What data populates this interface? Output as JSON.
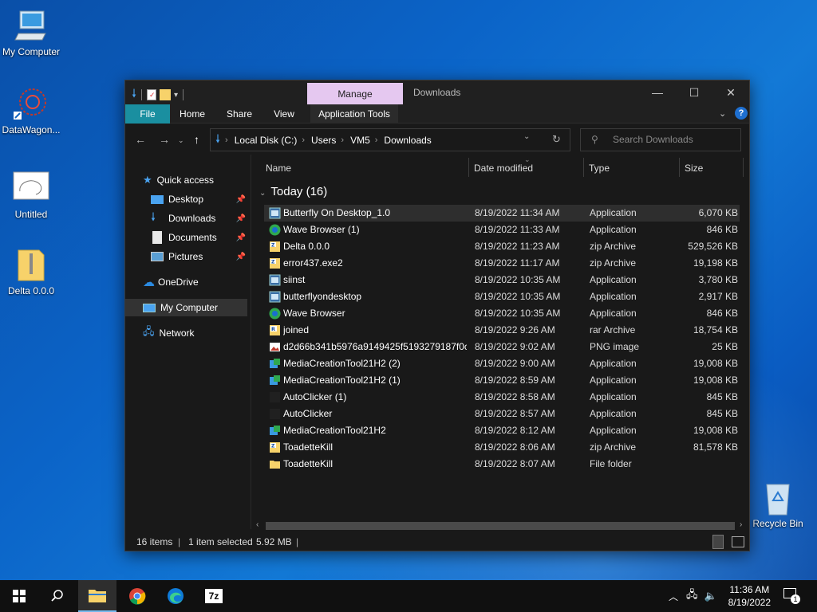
{
  "desktop": {
    "icons": [
      {
        "label": "My Computer"
      },
      {
        "label": "DataWagon..."
      },
      {
        "label": "Untitled"
      },
      {
        "label": "Delta 0.0.0"
      },
      {
        "label": "Recycle Bin"
      }
    ]
  },
  "window": {
    "manage_tab": "Manage",
    "title": "Downloads",
    "ribbon_tabs": [
      "File",
      "Home",
      "Share",
      "View",
      "Application Tools"
    ],
    "controls": {
      "minimize": "—",
      "maximize": "☐",
      "close": "✕"
    }
  },
  "address": {
    "crumbs": [
      "Local Disk (C:)",
      "Users",
      "VM5",
      "Downloads"
    ],
    "search_placeholder": "Search Downloads"
  },
  "nav": {
    "quick_access": "Quick access",
    "pinned": [
      "Desktop",
      "Downloads",
      "Documents",
      "Pictures"
    ],
    "onedrive": "OneDrive",
    "my_computer": "My Computer",
    "network": "Network"
  },
  "columns": {
    "name": "Name",
    "date": "Date modified",
    "type": "Type",
    "size": "Size"
  },
  "group": {
    "label": "Today (16)"
  },
  "files": [
    {
      "name": "Butterfly On Desktop_1.0",
      "date": "8/19/2022 11:34 AM",
      "type": "Application",
      "size": "6,070 KB",
      "icon": "app-installer-icon",
      "selected": true
    },
    {
      "name": "Wave Browser (1)",
      "date": "8/19/2022 11:33 AM",
      "type": "Application",
      "size": "846 KB",
      "icon": "wave-browser-icon"
    },
    {
      "name": "Delta 0.0.0",
      "date": "8/19/2022 11:23 AM",
      "type": "zip Archive",
      "size": "529,526 KB",
      "icon": "zip-icon"
    },
    {
      "name": "error437.exe2",
      "date": "8/19/2022 11:17 AM",
      "type": "zip Archive",
      "size": "19,198 KB",
      "icon": "zip-icon"
    },
    {
      "name": "siinst",
      "date": "8/19/2022 10:35 AM",
      "type": "Application",
      "size": "3,780 KB",
      "icon": "app-installer-icon"
    },
    {
      "name": "butterflyondesktop",
      "date": "8/19/2022 10:35 AM",
      "type": "Application",
      "size": "2,917 KB",
      "icon": "app-installer-icon"
    },
    {
      "name": "Wave Browser",
      "date": "8/19/2022 10:35 AM",
      "type": "Application",
      "size": "846 KB",
      "icon": "wave-browser-icon"
    },
    {
      "name": "joined",
      "date": "8/19/2022 9:26 AM",
      "type": "rar Archive",
      "size": "18,754 KB",
      "icon": "rar-icon"
    },
    {
      "name": "d2d66b341b5976a9149425f5193279187f0c...",
      "date": "8/19/2022 9:02 AM",
      "type": "PNG image",
      "size": "25 KB",
      "icon": "image-icon"
    },
    {
      "name": "MediaCreationTool21H2 (2)",
      "date": "8/19/2022 9:00 AM",
      "type": "Application",
      "size": "19,008 KB",
      "icon": "media-tool-icon"
    },
    {
      "name": "MediaCreationTool21H2 (1)",
      "date": "8/19/2022 8:59 AM",
      "type": "Application",
      "size": "19,008 KB",
      "icon": "media-tool-icon"
    },
    {
      "name": "AutoClicker (1)",
      "date": "8/19/2022 8:58 AM",
      "type": "Application",
      "size": "845 KB",
      "icon": "blank-app-icon"
    },
    {
      "name": "AutoClicker",
      "date": "8/19/2022 8:57 AM",
      "type": "Application",
      "size": "845 KB",
      "icon": "blank-app-icon"
    },
    {
      "name": "MediaCreationTool21H2",
      "date": "8/19/2022 8:12 AM",
      "type": "Application",
      "size": "19,008 KB",
      "icon": "media-tool-icon"
    },
    {
      "name": "ToadetteKill",
      "date": "8/19/2022 8:06 AM",
      "type": "zip Archive",
      "size": "81,578 KB",
      "icon": "zip-icon"
    },
    {
      "name": "ToadetteKill",
      "date": "8/19/2022 8:07 AM",
      "type": "File folder",
      "size": "",
      "icon": "folder-icon"
    }
  ],
  "status": {
    "count": "16 items",
    "selection": "1 item selected",
    "size": "5.92 MB"
  },
  "taskbar": {
    "time": "11:36 AM",
    "date": "8/19/2022",
    "notifications": "1"
  },
  "colors": {
    "accent": "#1a8fa0",
    "manage": "#e5c8f0",
    "folder": "#f7d26a"
  }
}
